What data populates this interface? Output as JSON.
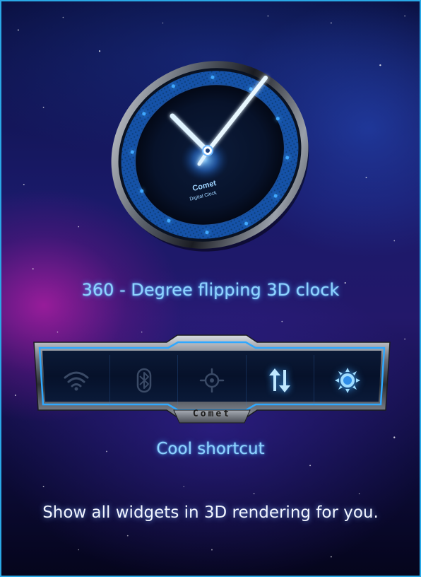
{
  "clock": {
    "brand": "Comet",
    "subtitle": "Digital Clock",
    "caption": "360 - Degree flipping 3D clock"
  },
  "shortcut_bar": {
    "brand": "Comet",
    "caption": "Cool shortcut",
    "buttons": [
      {
        "icon": "wifi-icon",
        "state": "off"
      },
      {
        "icon": "bluetooth-icon",
        "state": "off"
      },
      {
        "icon": "gps-icon",
        "state": "off"
      },
      {
        "icon": "data-sync-icon",
        "state": "on"
      },
      {
        "icon": "brightness-icon",
        "state": "on"
      }
    ]
  },
  "footer": {
    "text": "Show all widgets in 3D rendering for you."
  },
  "colors": {
    "accent": "#5cc8ff",
    "frame_border": "#2aa8e6",
    "icon_off": "#3a4a66",
    "icon_on": "#9fdcff"
  }
}
